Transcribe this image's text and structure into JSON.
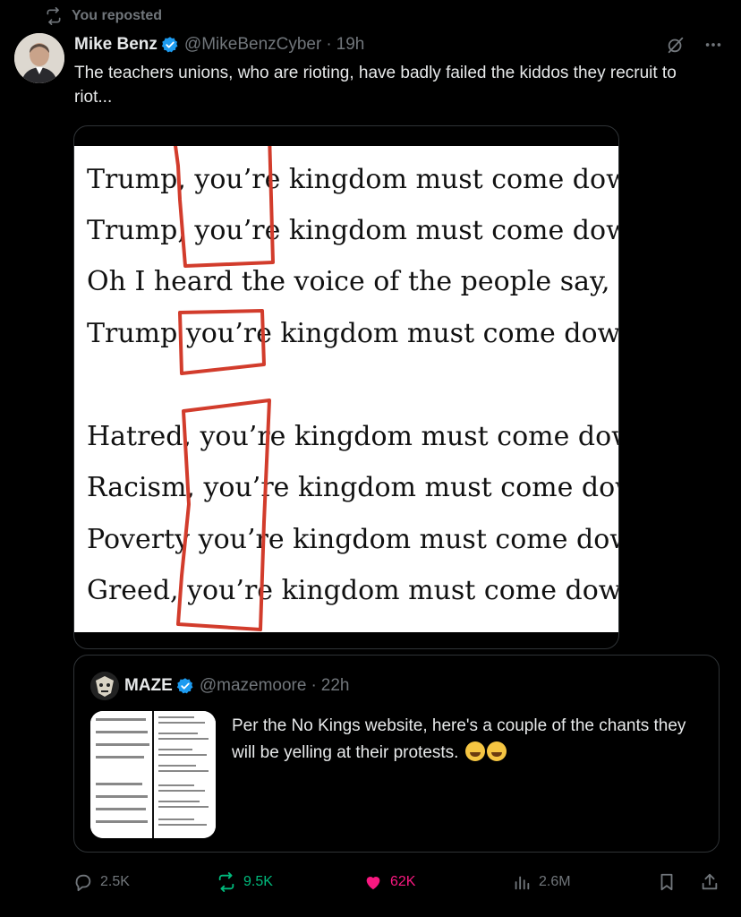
{
  "repost": {
    "label": "You reposted",
    "icon": "repost-icon"
  },
  "tweet": {
    "author": "Mike Benz",
    "handle": "@MikeBenzCyber",
    "separator": "·",
    "time": "19h",
    "text": "The teachers unions, who are rioting, have badly failed the kiddos they recruit to riot...",
    "verified_color": "#1d9bf0",
    "image_lines": [
      "Trump, you’re kingdom must come down*",
      "Trump, you’re kingdom must come down",
      "Oh I heard the voice of the people say,",
      "Trump you’re kingdom must come down",
      "Hatred, you’re kingdom must come down",
      "Racism, you’re kingdom must come down",
      "Poverty you’re kingdom must come down",
      "Greed, you’re kingdom must come down"
    ],
    "annotation_color": "#d23c2c"
  },
  "quote": {
    "author": "MAZE",
    "handle": "@mazemoore",
    "separator": "·",
    "time": "22h",
    "text": "Per the No Kings website, here's a couple of the chants they will be yelling at their protests."
  },
  "actions": {
    "replies": "2.5K",
    "reposts": "9.5K",
    "likes": "62K",
    "views": "2.6M",
    "repost_color": "#00ba7c",
    "like_color": "#f91880"
  }
}
